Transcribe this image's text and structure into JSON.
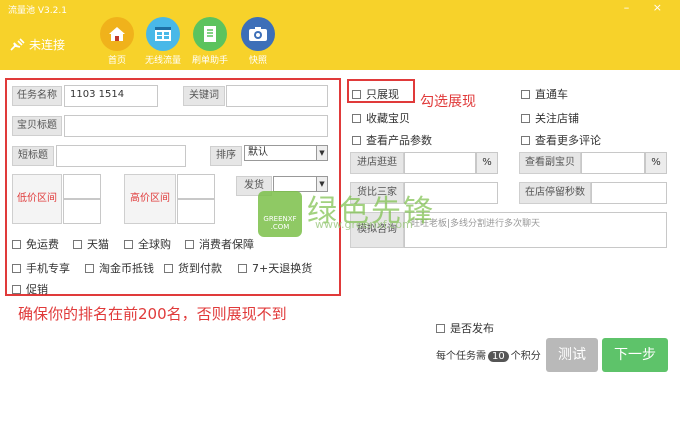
{
  "app": {
    "title": "流量池 V3.2.1",
    "window_controls": "– ×"
  },
  "connection": {
    "status": "未连接"
  },
  "nav": [
    {
      "label": "首页",
      "icon": "home-icon",
      "color": "#f0b21b"
    },
    {
      "label": "无线流量",
      "icon": "browser-icon",
      "color": "#49b8e8"
    },
    {
      "label": "刷单助手",
      "icon": "notebook-icon",
      "color": "#5cc35e"
    },
    {
      "label": "快照",
      "icon": "camera-icon",
      "color": "#3d6fb8"
    }
  ],
  "form": {
    "task_name_label": "任务名称",
    "task_name_value": "1103 1514",
    "keyword_label": "关键词",
    "item_title_label": "宝贝标题",
    "short_title_label": "短标题",
    "sort_label": "排序",
    "sort_value": "默认",
    "low_price_label": "低价区间",
    "high_price_label": "高价区间",
    "ship_label": "发货",
    "checkboxes": [
      {
        "label": "免运费"
      },
      {
        "label": "天猫"
      },
      {
        "label": "全球购"
      },
      {
        "label": "消费者保障"
      },
      {
        "label": "手机专享"
      },
      {
        "label": "淘金币抵钱"
      },
      {
        "label": "货到付款"
      },
      {
        "label": "7+天退换货"
      },
      {
        "label": "促销"
      }
    ]
  },
  "annotations": {
    "rank_note": "确保你的排名在前200名，否则展现不到",
    "show_only_note": "勾选展现"
  },
  "options": {
    "show_only": "只展现",
    "through_train": "直通车",
    "favorite_item": "收藏宝贝",
    "follow_shop": "关注店铺",
    "view_params": "查看产品参数",
    "view_more_reviews": "查看更多评论",
    "shop_visit_label": "进店逛逛",
    "shop_visit_unit": "%",
    "view_sub_item_label": "查看副宝贝",
    "view_sub_item_unit": "%",
    "compare_label": "货比三家",
    "stay_seconds_label": "在店停留秒数",
    "chat_label": "模拟咨询",
    "chat_placeholder": "旺旺老板|多线分割进行多次聊天"
  },
  "footer": {
    "publish_label": "是否发布",
    "cost_prefix": "每个任务需",
    "cost_value": "10",
    "cost_suffix": "个积分",
    "test_button": "测试",
    "next_button": "下一步"
  },
  "watermark": {
    "text": "绿色先锋",
    "sub": "GREENXF .COM",
    "url": "www.greenxf.com"
  }
}
